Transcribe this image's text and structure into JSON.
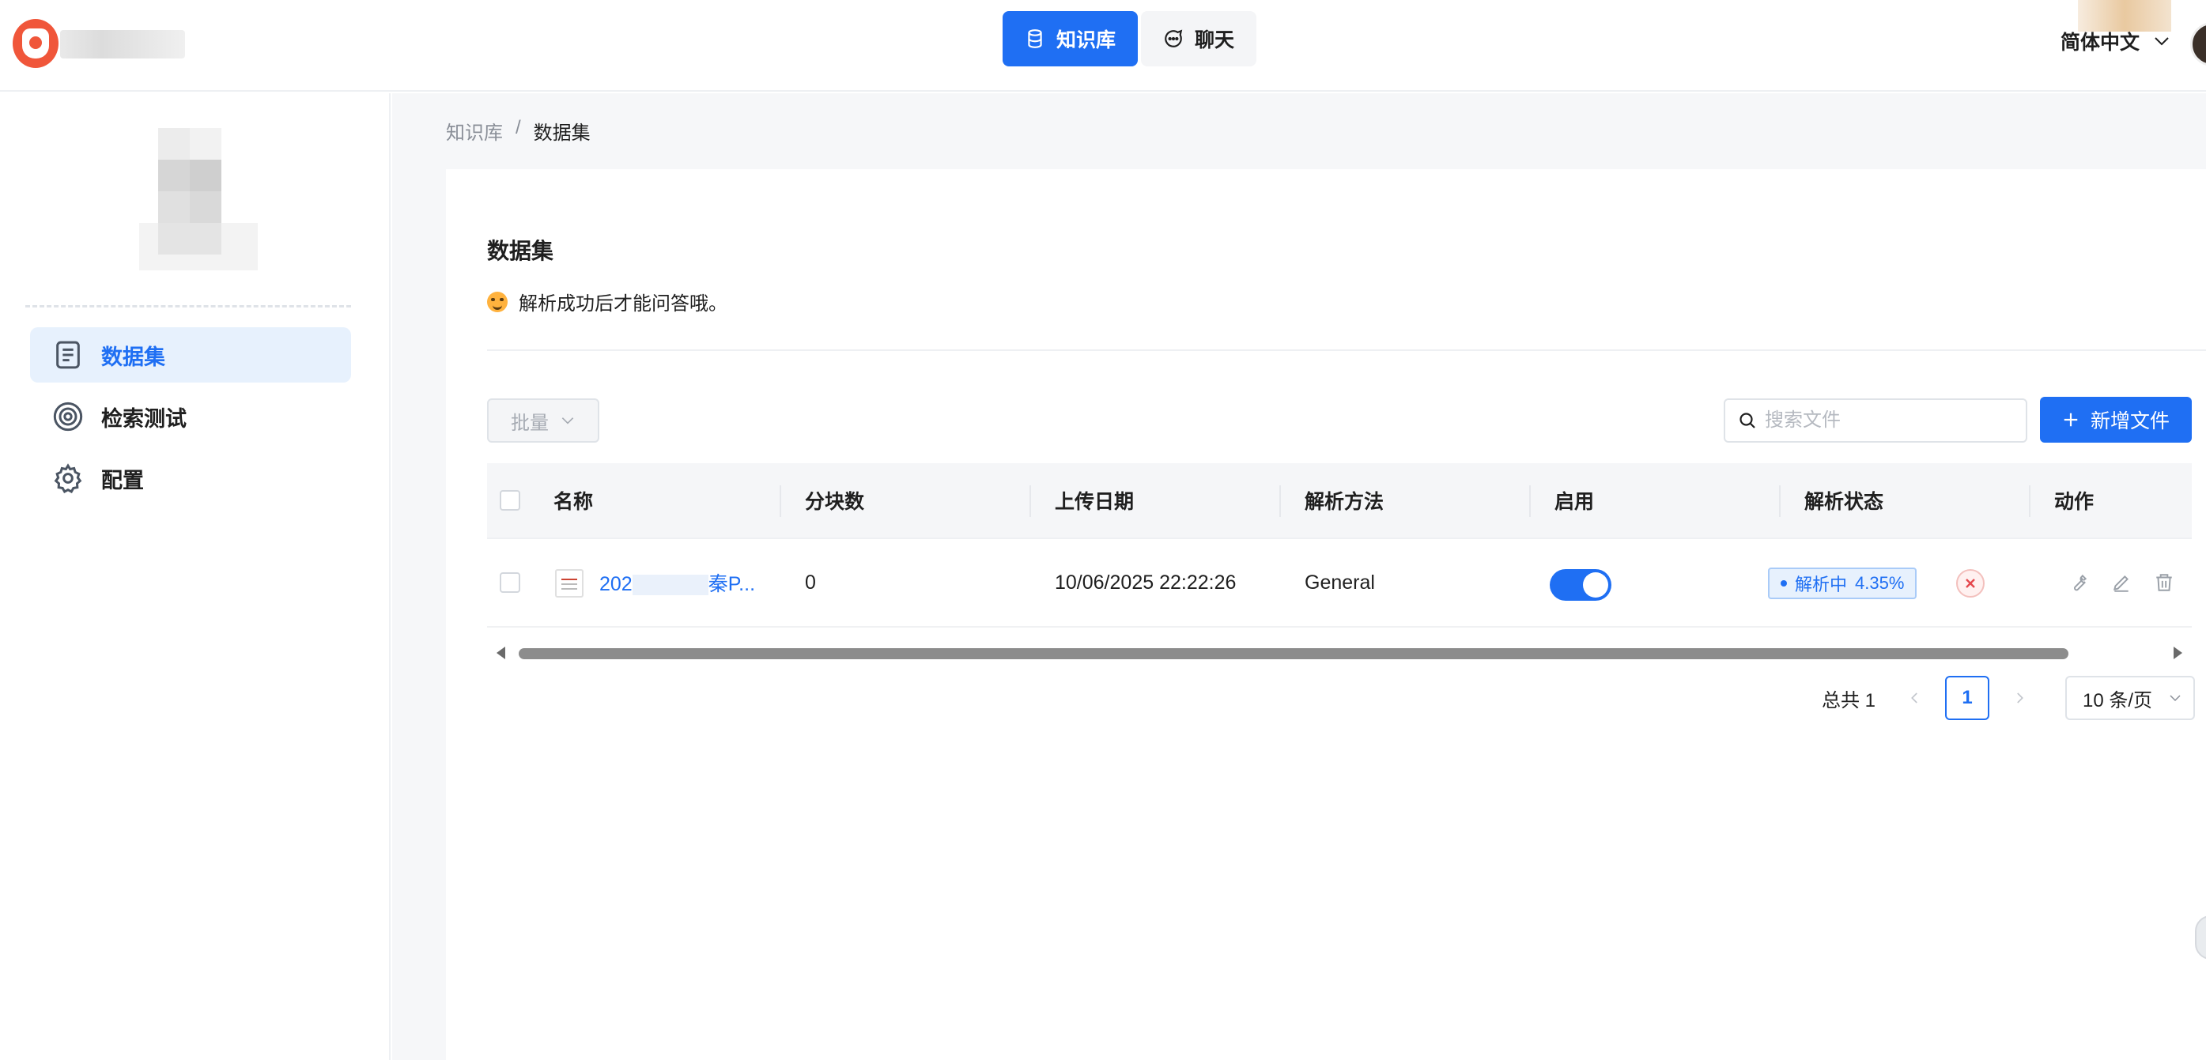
{
  "header": {
    "nav": [
      {
        "label": "知识库",
        "icon": "database-icon",
        "active": true
      },
      {
        "label": "聊天",
        "icon": "chat-icon",
        "active": false
      }
    ],
    "language": "简体中文"
  },
  "sidebar": {
    "items": [
      {
        "label": "数据集",
        "icon": "document-icon",
        "active": true
      },
      {
        "label": "检索测试",
        "icon": "target-icon",
        "active": false
      },
      {
        "label": "配置",
        "icon": "gear-icon",
        "active": false
      }
    ]
  },
  "breadcrumb": {
    "parent": "知识库",
    "separator": "/",
    "current": "数据集"
  },
  "page": {
    "title": "数据集",
    "tip": "解析成功后才能问答哦。"
  },
  "toolbar": {
    "batch_label": "批量",
    "search_placeholder": "搜索文件",
    "add_label": "新增文件"
  },
  "table": {
    "columns": [
      "名称",
      "分块数",
      "上传日期",
      "解析方法",
      "启用",
      "解析状态",
      "动作"
    ],
    "rows": [
      {
        "name_prefix": "202",
        "name_suffix": "秦P...",
        "chunks": "0",
        "upload_date": "10/06/2025 22:22:26",
        "parse_method": "General",
        "enabled": true,
        "status_label": "解析中",
        "status_progress": "4.35%"
      }
    ]
  },
  "pagination": {
    "total": "总共 1",
    "current_page": "1",
    "page_size": "10 条/页"
  },
  "colors": {
    "primary": "#1f6ff3",
    "active_bg": "#e7f1fd",
    "danger": "#e5484d"
  }
}
